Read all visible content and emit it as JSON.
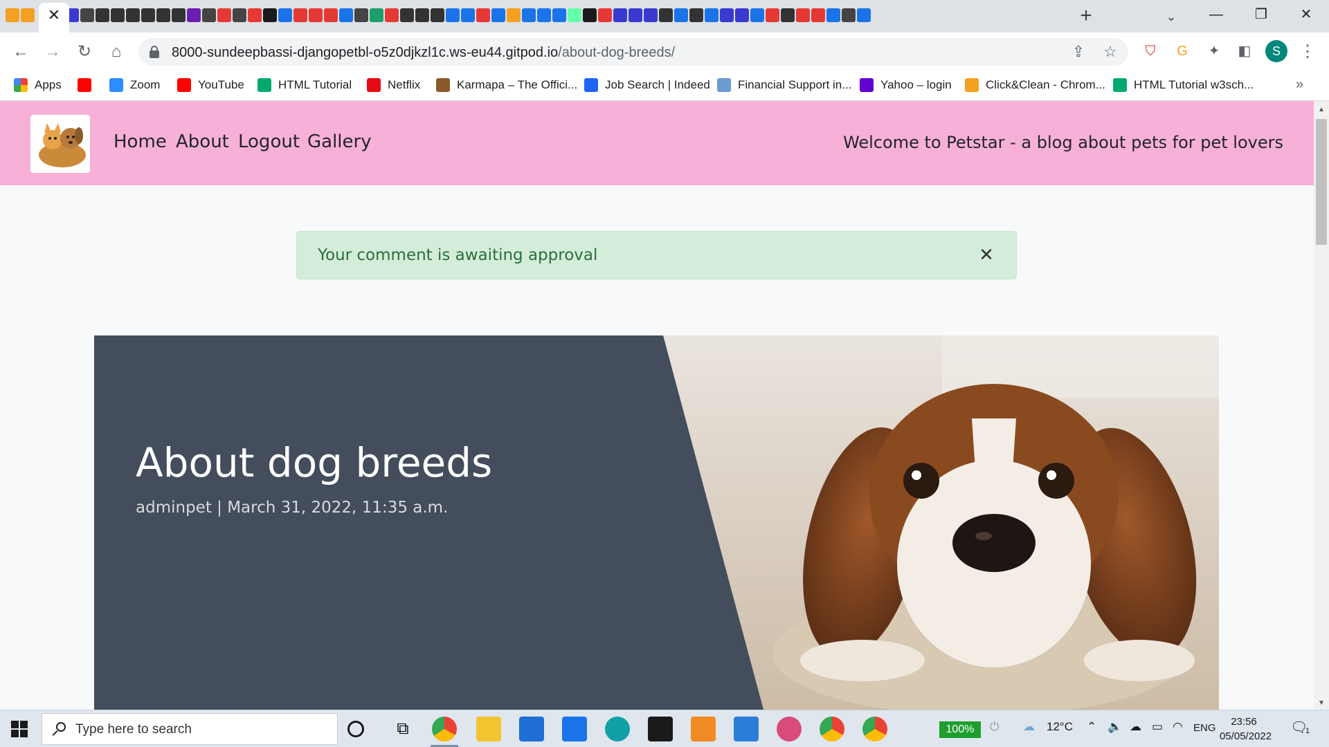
{
  "browser": {
    "tab_close_glyph": "✕",
    "new_tab_glyph": "+",
    "tab_search_glyph": "⌄",
    "window_controls": {
      "minimize": "—",
      "restore": "❐",
      "close": "✕"
    },
    "tab_favicon_colors": [
      "#f4a020",
      "#f4a020",
      "#3a3ad0",
      "#444",
      "#333",
      "#333",
      "#333",
      "#333",
      "#333",
      "#333",
      "#6b1fb1",
      "#444",
      "#e53935",
      "#444",
      "#e53935",
      "#1a1a1a",
      "#1a73e8",
      "#e53935",
      "#e53935",
      "#e53935",
      "#1a73e8",
      "#444",
      "#1e9e6a",
      "#e53935",
      "#333",
      "#333",
      "#333",
      "#1a73e8",
      "#1a73e8",
      "#e53935",
      "#1a73e8",
      "#f4a020",
      "#1a73e8",
      "#1a73e8",
      "#1a73e8",
      "#6fa",
      "#1a1a1a",
      "#e53935",
      "#3a3ad0",
      "#3a3ad0",
      "#3a3ad0",
      "#333",
      "#1a73e8",
      "#333",
      "#1a73e8",
      "#3a3ad0",
      "#3a3ad0",
      "#1a73e8",
      "#e53935",
      "#333",
      "#e53935",
      "#e53935",
      "#1a73e8",
      "#444",
      "#1a73e8"
    ]
  },
  "toolbar": {
    "back_glyph": "←",
    "forward_glyph": "→",
    "reload_glyph": "↻",
    "home_glyph": "⌂",
    "url_host": "8000-sundeepbassi-djangopetbl-o5z0djkzl1c.ws-eu44.gitpod.io",
    "url_path": "/about-dog-breeds/",
    "share_glyph": "⇪",
    "star_glyph": "☆",
    "extensions_glyph": "✦",
    "profile_initial": "S",
    "menu_glyph": "⋮"
  },
  "bookmarks": {
    "items": [
      {
        "label": "Apps",
        "color": "#ea4335"
      },
      {
        "label": "",
        "color": "#ff0000"
      },
      {
        "label": "Zoom",
        "color": "#2d8cff"
      },
      {
        "label": "YouTube",
        "color": "#ff0000"
      },
      {
        "label": "HTML Tutorial",
        "color": "#04aa6d"
      },
      {
        "label": "Netflix",
        "color": "#e50914"
      },
      {
        "label": "Karmapa – The Offici...",
        "color": "#8a5a2b"
      },
      {
        "label": "Job Search | Indeed",
        "color": "#2164f3"
      },
      {
        "label": "Financial Support in...",
        "color": "#6c9bd2"
      },
      {
        "label": "Yahoo – login",
        "color": "#6001d2"
      },
      {
        "label": "Click&Clean - Chrom...",
        "color": "#f4a020"
      },
      {
        "label": "HTML Tutorial w3sch...",
        "color": "#04aa6d"
      }
    ],
    "more_glyph": "»"
  },
  "site": {
    "nav": [
      {
        "label": "Home"
      },
      {
        "label": "About"
      },
      {
        "label": "Logout"
      },
      {
        "label": "Gallery"
      }
    ],
    "tagline": "Welcome to Petstar - a blog about pets for pet lovers"
  },
  "alert": {
    "message": "Your comment is awaiting approval",
    "close_glyph": "✕"
  },
  "post": {
    "title": "About dog breeds",
    "meta": "adminpet | March 31, 2022, 11:35 a.m."
  },
  "taskbar": {
    "search_placeholder": "Type here to search",
    "battery": "100%",
    "temperature": "12°C",
    "language": "ENG",
    "time": "23:56",
    "date": "05/05/2022",
    "notification_count": "1"
  }
}
